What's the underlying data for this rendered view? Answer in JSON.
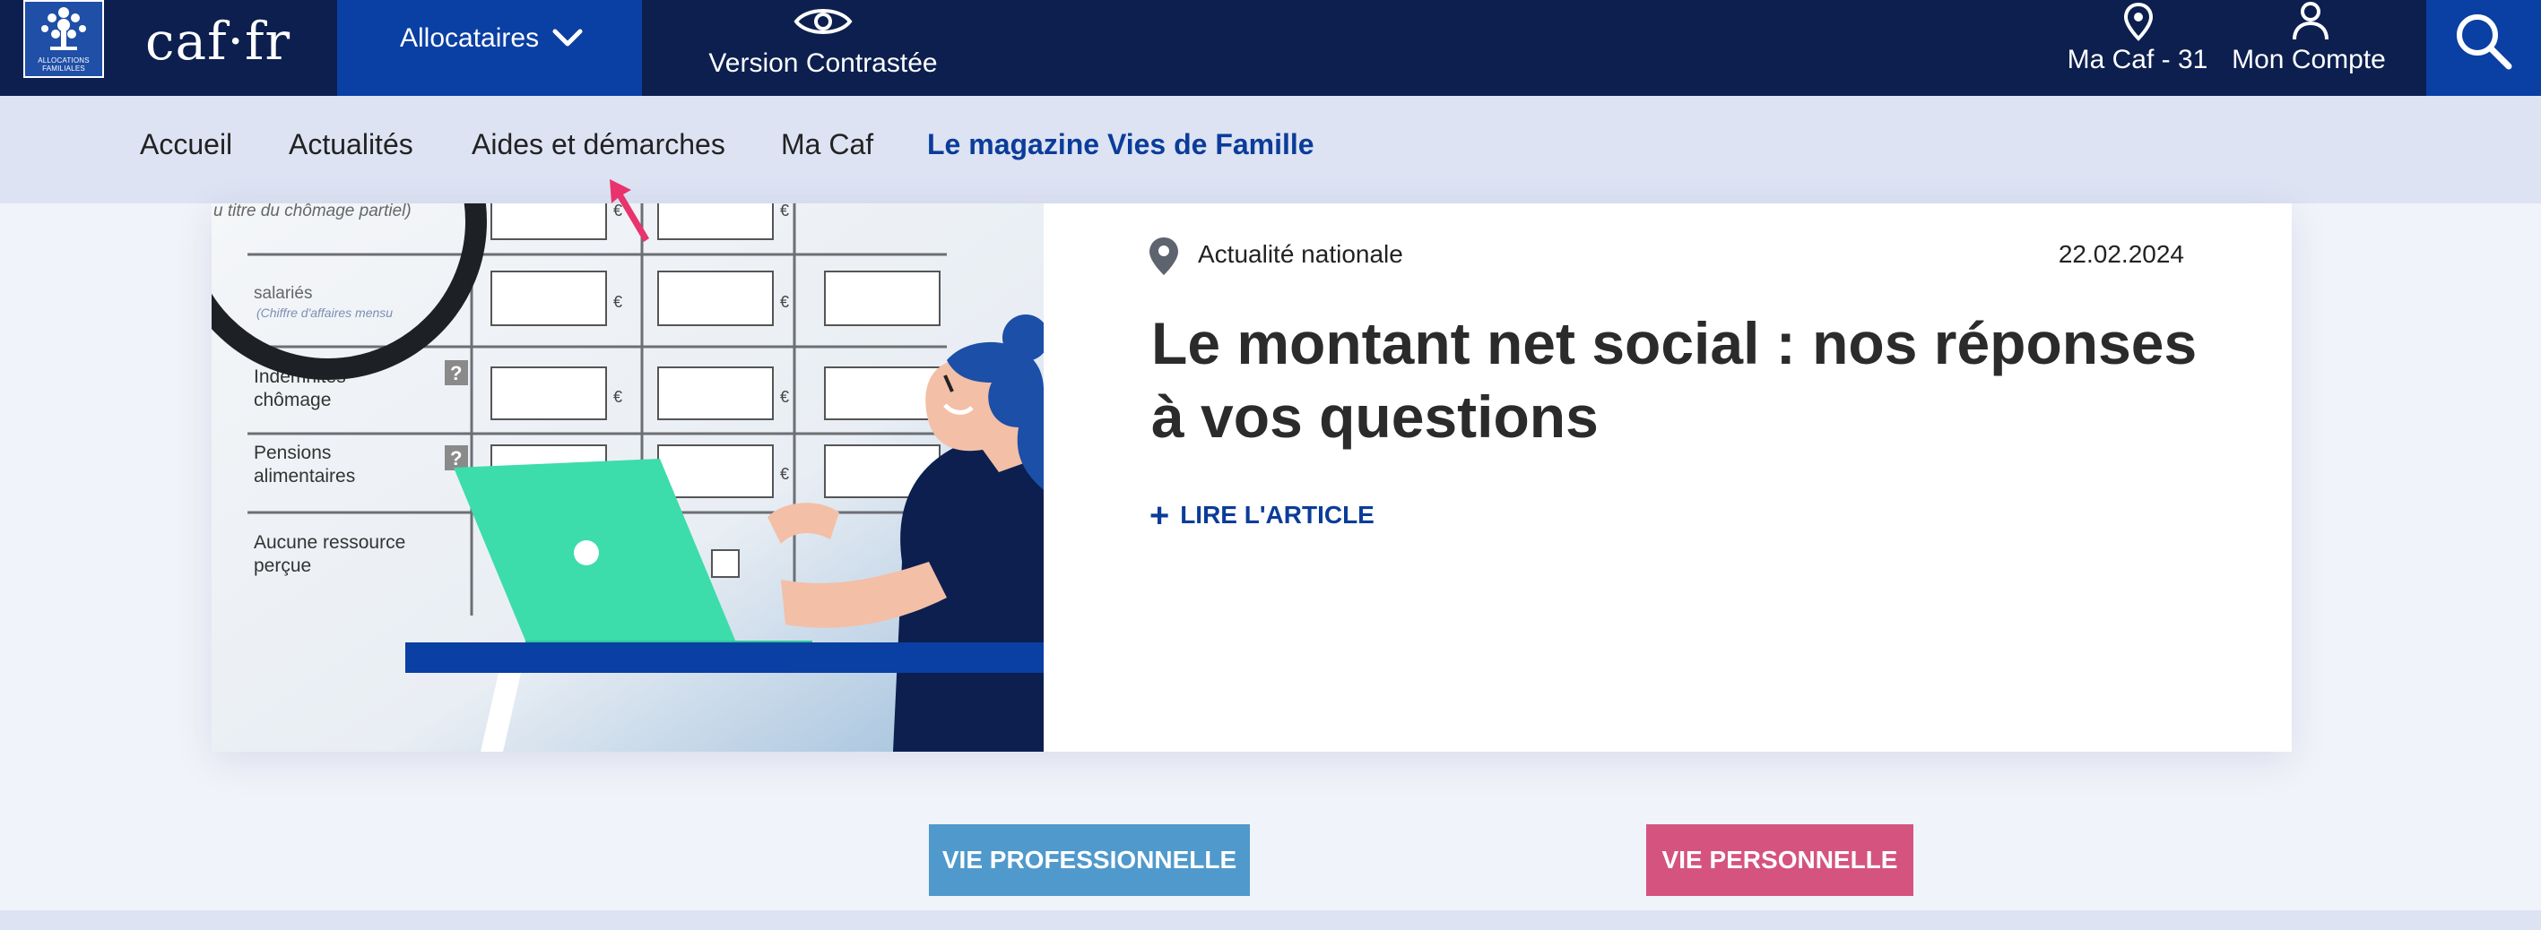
{
  "header": {
    "logo_text": "ALLOCATIONS FAMILIALES",
    "brand": "caf·fr",
    "menu_label": "Allocataires",
    "contrast_label": "Version Contrastée",
    "local_caf_label": "Ma Caf - 31",
    "account_label": "Mon Compte"
  },
  "subnav": {
    "items": [
      "Accueil",
      "Actualités",
      "Aides et démarches",
      "Ma Caf",
      "Le magazine Vies de Famille"
    ]
  },
  "article": {
    "category": "Actualité nationale",
    "date": "22.02.2024",
    "title": "Le montant net social : nos réponses à vos questions",
    "read_more": "LIRE L'ARTICLE"
  },
  "illustration": {
    "form_lines": {
      "partial": "u titre du chômage partiel)",
      "salaries": "salariés",
      "salaries_note": "(Chiffre d'affaires mensu",
      "indemnites": "Indemnités",
      "chomage": "chômage",
      "pensions": "Pensions",
      "alimentaires": "alimentaires",
      "aucune": "Aucune ressource",
      "percue": "perçue",
      "euro": "€",
      "help": "?"
    }
  },
  "buttons": {
    "pro": "VIE PROFESSIONNELLE",
    "perso": "VIE PERSONNELLE"
  },
  "colors": {
    "topbar": "#0c1f4f",
    "active_blue": "#0a3fa3",
    "subnav_bg": "#dde3f3",
    "link_blue": "#0b3c99",
    "btn_pro": "#4f99cc",
    "btn_perso": "#d5537f"
  }
}
